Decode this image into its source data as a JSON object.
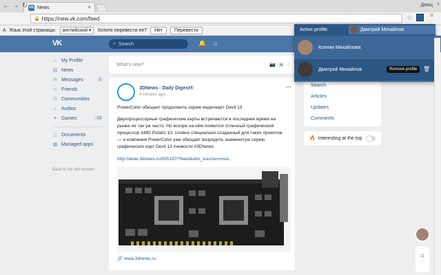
{
  "browser": {
    "tab_title": "News",
    "tab_favicon": "VK",
    "user_name": "Дмиц",
    "url": "https://new.vk.com/feed",
    "translate_bar": {
      "label": "Язык этой страницы:",
      "language": "английский",
      "question": "Хотите перевести ее?",
      "no_button": "Нет",
      "translate_button": "Перевести"
    }
  },
  "header": {
    "logo": "VK",
    "search_placeholder": "Search"
  },
  "sidebar": {
    "items": [
      {
        "label": "My Profile",
        "icon": "home-icon"
      },
      {
        "label": "News",
        "icon": "news-icon"
      },
      {
        "label": "Messages",
        "icon": "message-icon",
        "count": "1"
      },
      {
        "label": "Friends",
        "icon": "friends-icon"
      },
      {
        "label": "Communities",
        "icon": "communities-icon"
      },
      {
        "label": "Audios",
        "icon": "music-icon"
      },
      {
        "label": "Games",
        "icon": "games-icon",
        "count": "13"
      }
    ],
    "items2": [
      {
        "label": "Documents",
        "icon": "document-icon"
      },
      {
        "label": "Managed apps",
        "icon": "apps-icon"
      }
    ],
    "back_link": "Back to the old version"
  },
  "feed": {
    "whats_new_placeholder": "What's new?",
    "post": {
      "author": "3DNews - Daily Digest®",
      "time": "4 minutes ago",
      "headline": "PowerColor обещает продолжить серию видеокарт Devil 13",
      "body_lines": [
        "Двухпроцессорные графические карты встречаются в последнее время на",
        "рынке не так уж часто. Но вскоре на нём появится отличный графический",
        "процессор AMD Polaris 10, словно специально созданный для таких проектов.",
        "— и компания PowerColor уже обещает возродить знаменитую серию",
        "графических карт Devil 13 #новости #3DNews"
      ],
      "link": "http://www.3dnews.ru/935197/?feed&utm_source=nova..",
      "source": "www.3dnews.ru"
    }
  },
  "right_menu": {
    "items": [
      "Search",
      "Articles",
      "Updates",
      "Comments"
    ],
    "interesting_label": "Interesting at the top"
  },
  "popup": {
    "active_label": "Active profile",
    "current_profile": "Дмитрий Михайлов",
    "profiles": [
      "Ксения Михайлова",
      "Дмитрий Михайлов"
    ],
    "tooltip": "Remove profile"
  },
  "chat": {
    "count": "11"
  },
  "colors": {
    "vk_blue": "#4a76a8",
    "popup_blue": "#3d6796",
    "link": "#2a5885"
  }
}
